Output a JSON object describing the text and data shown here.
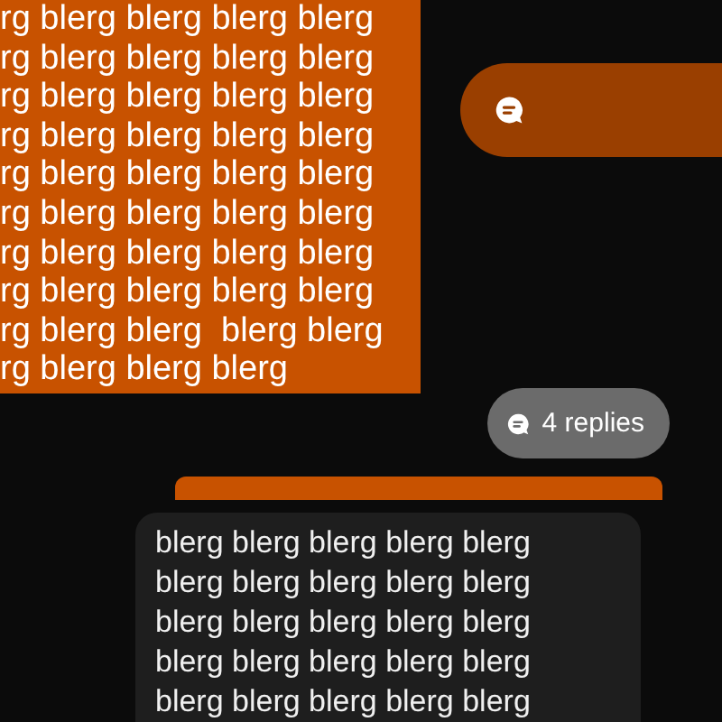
{
  "outgoing_message": {
    "lines": [
      "rg blerg blerg blerg blerg",
      "rg blerg blerg blerg blerg",
      "rg blerg blerg blerg blerg",
      "rg blerg blerg blerg blerg",
      "rg blerg blerg blerg blerg",
      "rg blerg blerg blerg blerg",
      "rg blerg blerg blerg blerg",
      "rg blerg blerg blerg blerg",
      "rg blerg blerg  blerg blerg",
      "rg blerg blerg blerg"
    ]
  },
  "thread_pill": {
    "label": "4 replies"
  },
  "incoming_message": {
    "lines": [
      "blerg blerg blerg blerg blerg",
      "blerg blerg blerg blerg blerg",
      "blerg blerg blerg blerg blerg",
      "blerg blerg blerg blerg blerg",
      "blerg blerg blerg blerg blerg"
    ]
  }
}
